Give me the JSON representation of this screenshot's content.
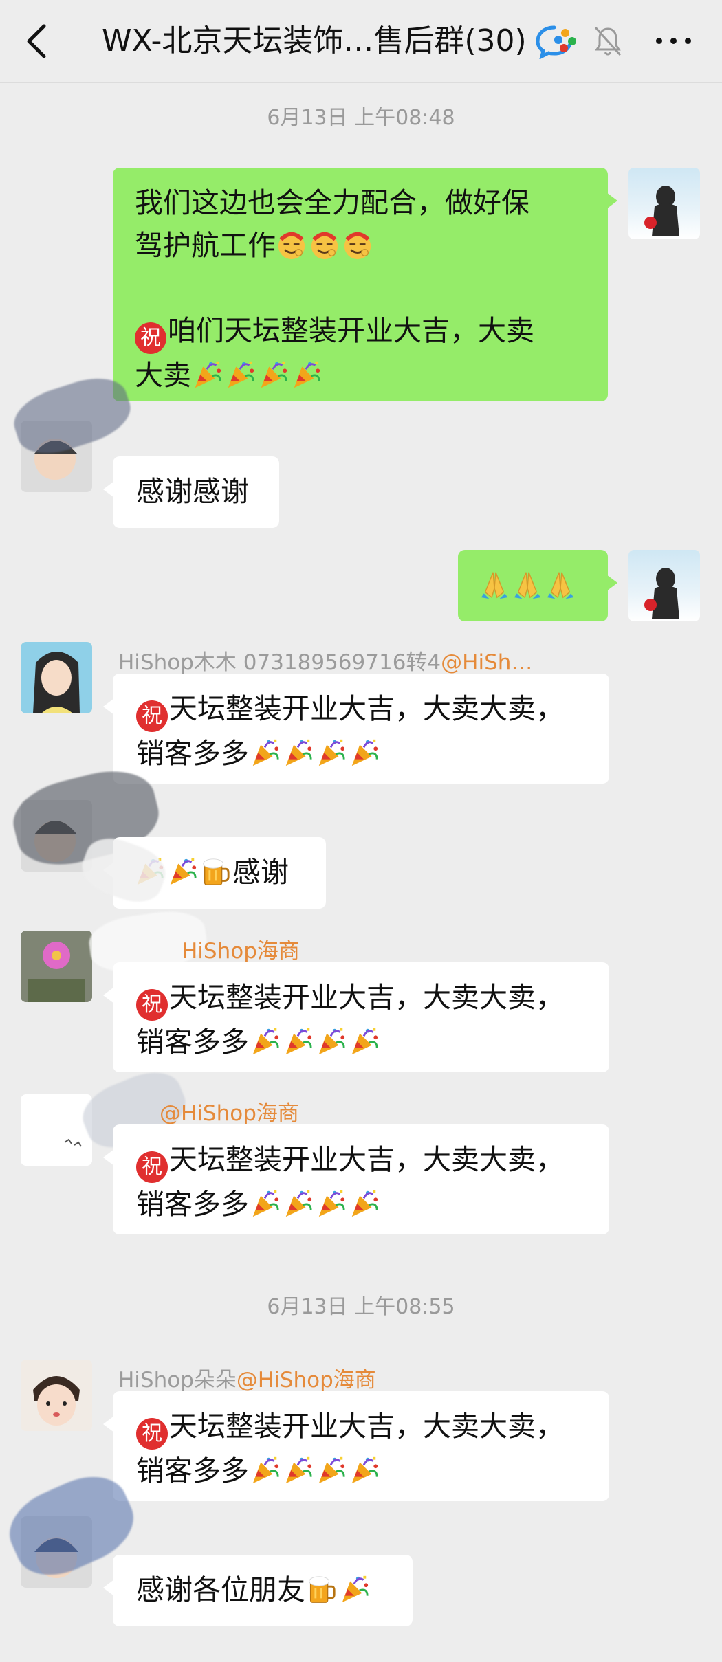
{
  "header": {
    "title": "WX-北京天坛装饰…售后群(30)"
  },
  "icons": {
    "back": "back-chevron-icon",
    "wecom": "wecom-logo-icon",
    "mute": "bell-muted-icon",
    "more": "more-dots-icon",
    "blessing": "zhu-blessing-icon",
    "party": "party-popper-icon",
    "grin": "grinning-face-icon",
    "pray": "folded-hands-icon",
    "beer": "beer-mug-icon",
    "confetti": "confetti-icon"
  },
  "colors": {
    "background": "#ededed",
    "my_bubble": "#95ec69",
    "other_bubble": "#ffffff",
    "mention": "#e58a3a",
    "sender_name": "#9b9b9b",
    "blessing_badge": "#e02f2f"
  },
  "timestamps": [
    "6月13日 上午08:48",
    "6月13日 上午08:55"
  ],
  "messages": {
    "m1": {
      "line1": "我们这边也会全力配合，做好保",
      "line2": "驾护航工作",
      "line3": "咱们天坛整装开业大吉，大卖",
      "line4": "大卖"
    },
    "m2": {
      "line1": "感谢感谢"
    },
    "m4": {
      "sender": "HiShop木木 07318956971​6转4",
      "mention": "@HiSh…",
      "line1": "天坛整装开业大吉，大卖大卖，",
      "line2": "销客多多"
    },
    "m5": {
      "text": "感谢"
    },
    "m6": {
      "mention": "HiShop海商",
      "line1": "天坛整装开业大吉，大卖大卖，",
      "line2": "销客多多"
    },
    "m7": {
      "mention": "@HiShop海商",
      "line1": "天坛整装开业大吉，大卖大卖，",
      "line2": "销客多多"
    },
    "m8": {
      "sender": "HiShop朵朵",
      "mention": "@HiShop海商",
      "line1": "天坛整装开业大吉，大卖大卖，",
      "line2": "销客多多"
    },
    "m9": {
      "text": "感谢各位朋友"
    }
  },
  "blessing_char": "祝"
}
